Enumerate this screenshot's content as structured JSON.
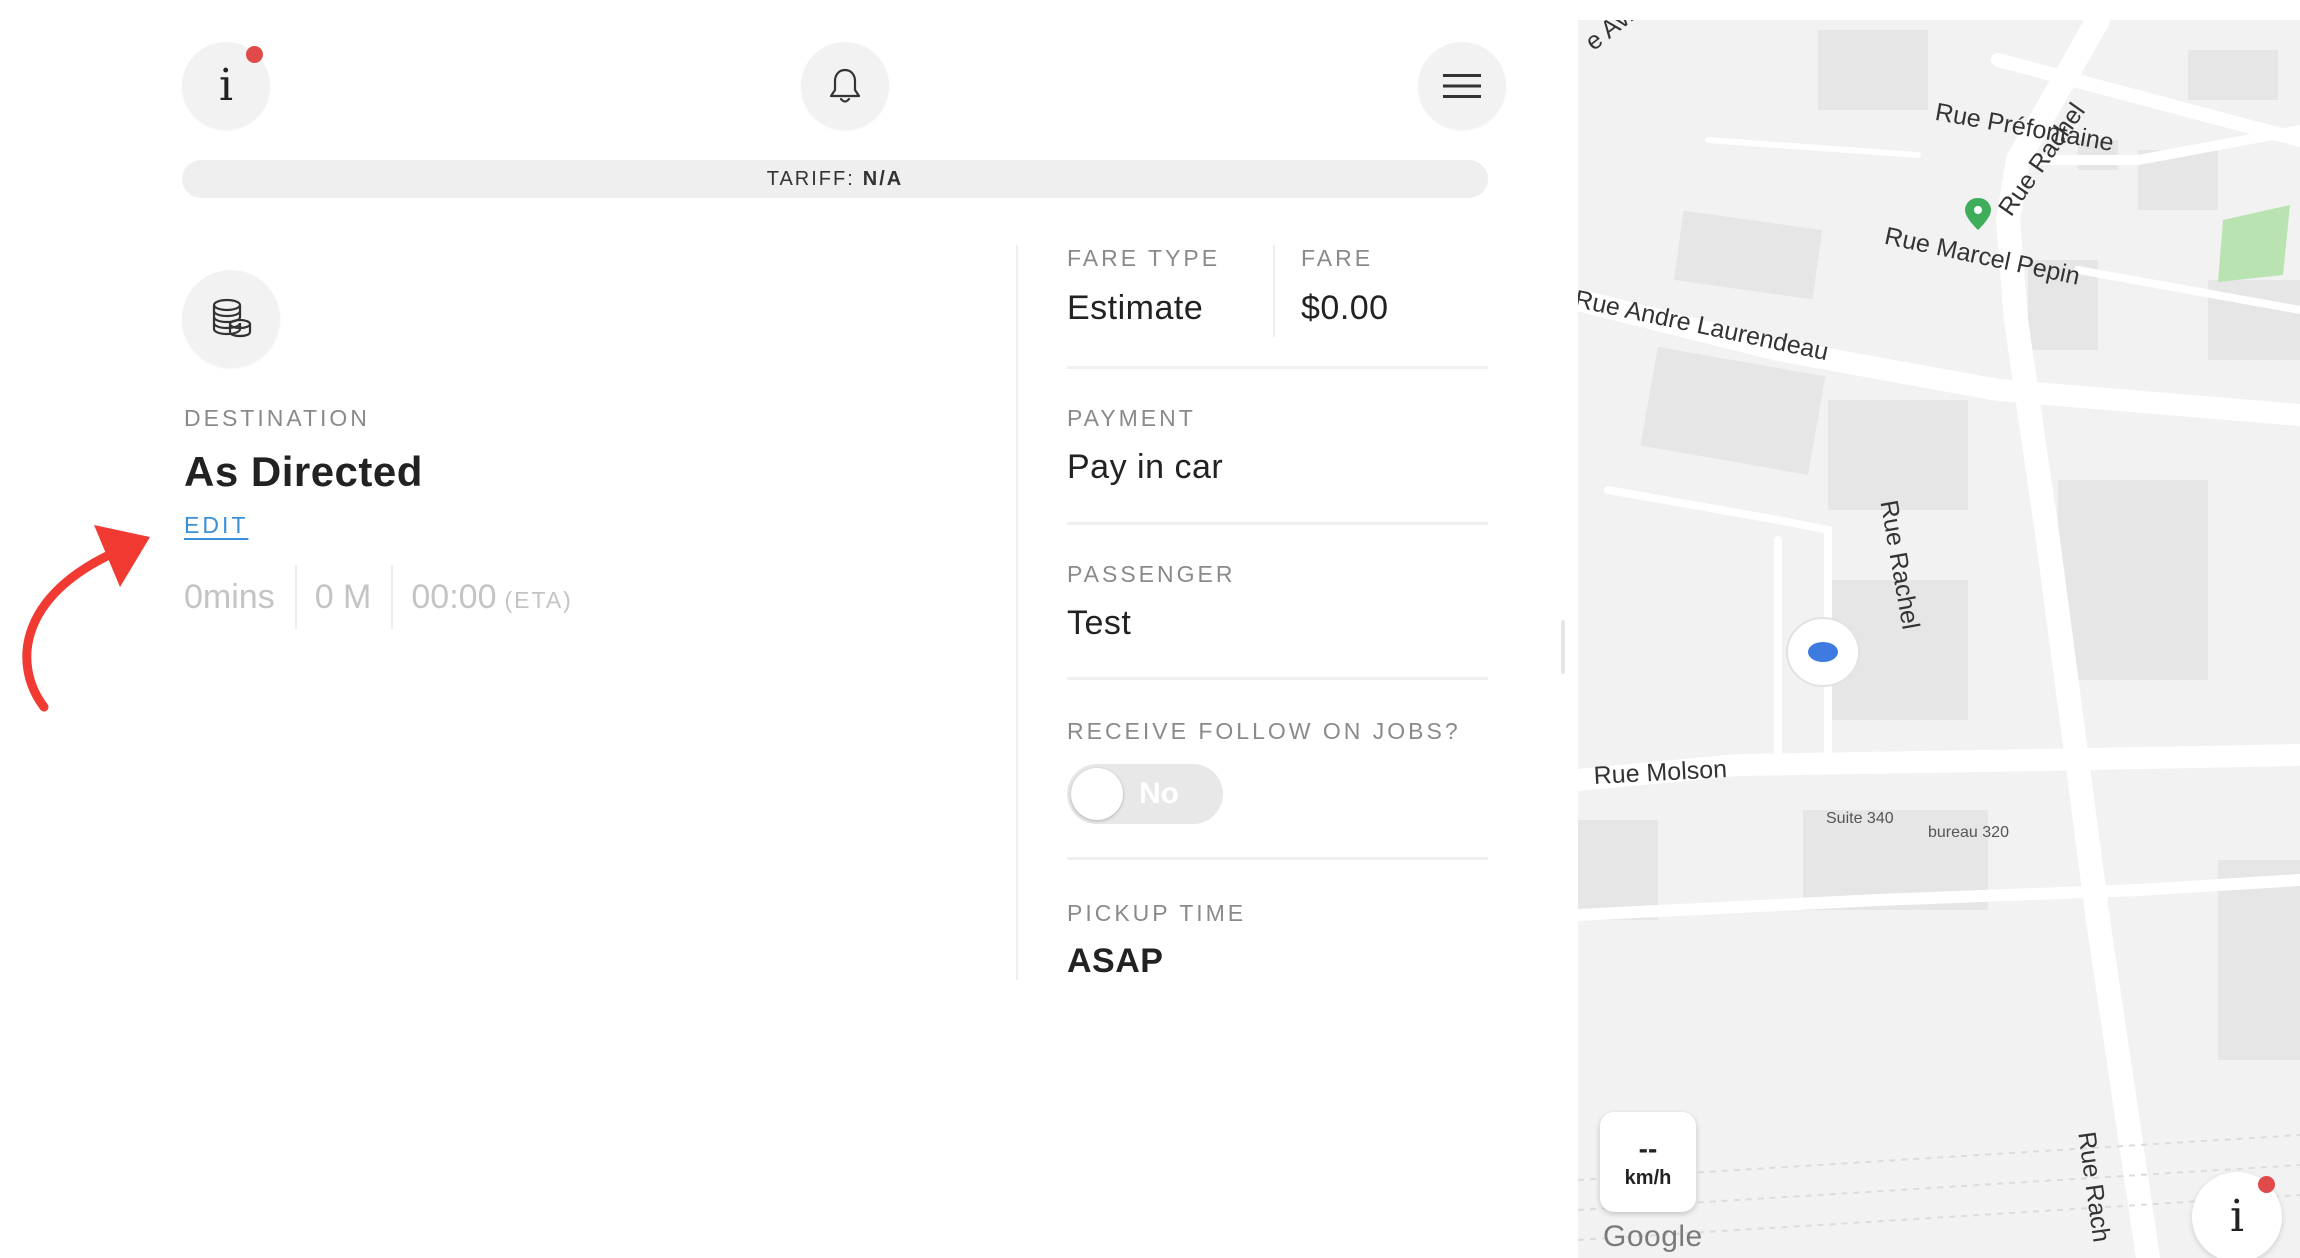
{
  "header": {
    "info_glyph": "i",
    "info_badge_color": "#e04a4a",
    "bell_icon": "bell-icon",
    "menu_icon": "hamburger-menu-icon"
  },
  "tariff": {
    "label": "TARIFF:",
    "value": "N/A"
  },
  "destination": {
    "icon": "coins-stack-icon",
    "label": "DESTINATION",
    "value": "As Directed",
    "edit_label": "EDIT",
    "duration": "0mins",
    "distance": "0 M",
    "eta_time": "00:00",
    "eta_suffix": "(ETA)"
  },
  "annotation": {
    "arrow_color": "#f03a32",
    "icon": "curved-arrow-icon"
  },
  "details": {
    "fare_type": {
      "label": "FARE TYPE",
      "value": "Estimate"
    },
    "fare": {
      "label": "FARE",
      "value": "$0.00"
    },
    "payment": {
      "label": "PAYMENT",
      "value": "Pay in car"
    },
    "passenger": {
      "label": "PASSENGER",
      "value": "Test"
    },
    "follow_on": {
      "label": "RECEIVE FOLLOW ON JOBS?",
      "toggle_text": "No",
      "enabled": false
    },
    "pickup_time": {
      "label": "PICKUP TIME",
      "value": "ASAP"
    }
  },
  "map": {
    "streets": {
      "william_tremblay": "e Av. William-Trem",
      "prefontaine": "Rue Préfontaine",
      "rachel_top": "Rue Rachel",
      "marcel_pepin": "Rue Marcel Pepin",
      "andre_laurendeau": "Rue Andre Laurendeau",
      "rachel_mid": "Rue Rachel",
      "molson": "Rue Molson",
      "rachel_bottom": "Rue Rach"
    },
    "labels": {
      "suite": "Suite 340",
      "bureau": "bureau 320"
    },
    "speed": {
      "value": "--",
      "unit": "km/h"
    },
    "logo": "Google",
    "info_glyph": "i",
    "location_dot_color": "#3d7be0",
    "poi_color": "#3fae5a",
    "park_color": "#b9e3b0"
  }
}
